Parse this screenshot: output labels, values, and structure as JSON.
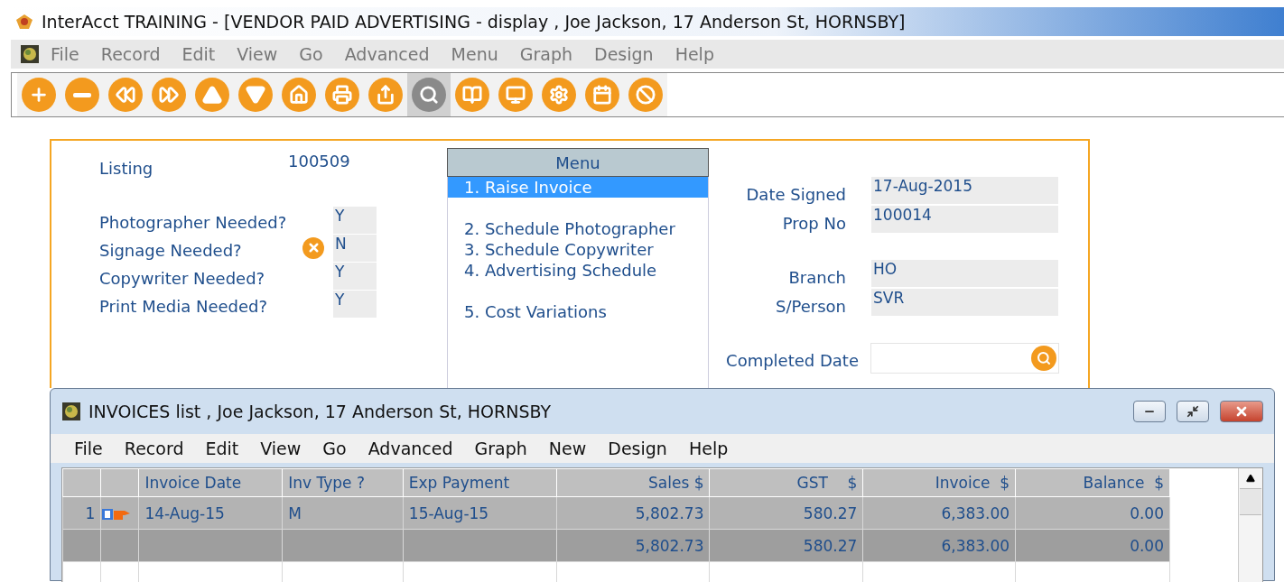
{
  "window": {
    "title": "InterAcct TRAINING - [VENDOR PAID ADVERTISING - display , Joe Jackson, 17 Anderson St, HORNSBY]"
  },
  "menu": [
    "File",
    "Record",
    "Edit",
    "View",
    "Go",
    "Advanced",
    "Menu",
    "Graph",
    "Design",
    "Help"
  ],
  "toolbar": [
    {
      "selected": false
    },
    {
      "selected": false
    },
    {
      "selected": false
    },
    {
      "selected": false
    },
    {
      "selected": false
    },
    {
      "selected": false
    },
    {
      "selected": false
    },
    {
      "selected": false
    },
    {
      "selected": false
    },
    {
      "selected": true
    },
    {
      "selected": false
    },
    {
      "selected": false
    },
    {
      "selected": false
    },
    {
      "selected": false
    },
    {
      "selected": false
    }
  ],
  "form": {
    "listing": {
      "label": "Listing",
      "value": "100509"
    },
    "flags": [
      {
        "label": "Photographer Needed?",
        "value": "Y",
        "error": false
      },
      {
        "label": "Signage Needed?",
        "value": "N",
        "error": true
      },
      {
        "label": "Copywriter Needed?",
        "value": "Y",
        "error": false
      },
      {
        "label": "Print Media Needed?",
        "value": "Y",
        "error": false
      }
    ],
    "menu_title": "Menu",
    "menu_groups": [
      {
        "items": [
          {
            "label": "1. Raise Invoice",
            "selected": true
          }
        ]
      },
      {
        "items": [
          {
            "label": "2. Schedule Photographer",
            "selected": false
          },
          {
            "label": "3. Schedule Copywriter",
            "selected": false
          },
          {
            "label": "4. Advertising Schedule",
            "selected": false
          }
        ]
      },
      {
        "items": [
          {
            "label": "5. Cost Variations",
            "selected": false
          }
        ]
      }
    ],
    "detail_groups": [
      {
        "items": [
          {
            "label": "Date Signed",
            "value": "17-Aug-2015"
          },
          {
            "label": "Prop No",
            "value": "100014"
          }
        ]
      },
      {
        "items": [
          {
            "label": "Branch",
            "value": "HO"
          },
          {
            "label": "S/Person",
            "value": "SVR"
          }
        ]
      }
    ],
    "completed_date": {
      "label": "Completed Date"
    }
  },
  "invoices": {
    "title": "INVOICES list , Joe Jackson, 17 Anderson St, HORNSBY",
    "menu": [
      "File",
      "Record",
      "Edit",
      "View",
      "Go",
      "Advanced",
      "Graph",
      "New",
      "Design",
      "Help"
    ],
    "columns": [
      {
        "label": "Invoice Date",
        "kind": "text"
      },
      {
        "label": "Inv Type ?",
        "kind": "text"
      },
      {
        "label": "Exp Payment",
        "kind": "text"
      },
      {
        "label": "Sales $",
        "kind": "amount"
      },
      {
        "label": "GST    $",
        "kind": "amount"
      },
      {
        "label": "Invoice  $",
        "kind": "amount"
      },
      {
        "label": "Balance  $",
        "kind": "amount"
      }
    ],
    "rows": [
      {
        "kind": "data",
        "number": "1",
        "current": true,
        "cells": [
          "14-Aug-15",
          "M",
          "15-Aug-15",
          "5,802.73",
          "580.27",
          "6,383.00",
          "0.00"
        ]
      },
      {
        "kind": "total",
        "number": "",
        "current": false,
        "cells": [
          "",
          "",
          "",
          "5,802.73",
          "580.27",
          "6,383.00",
          "0.00"
        ]
      },
      {
        "kind": "empty",
        "number": "",
        "current": false,
        "cells": [
          "",
          "",
          "",
          "",
          "",
          "",
          ""
        ]
      }
    ]
  }
}
